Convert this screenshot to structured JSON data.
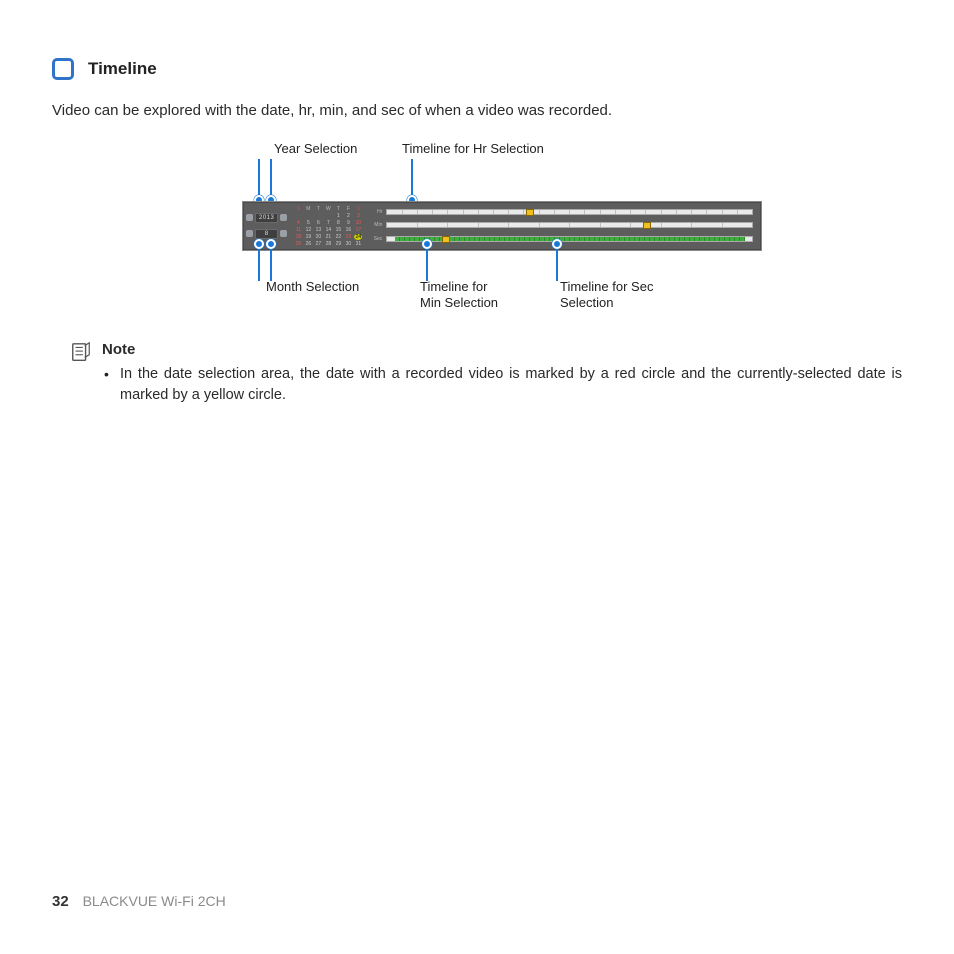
{
  "heading": "Timeline",
  "intro": "Video can be explored with the date, hr, min, and sec of when a video was recorded.",
  "labels": {
    "year": "Year Selection",
    "hr": "Timeline for Hr Selection",
    "month": "Month Selection",
    "min": "Timeline for\nMin Selection",
    "sec": "Timeline for Sec\nSelection"
  },
  "ui": {
    "year": "2013",
    "month": "8",
    "days_header": [
      "S",
      "M",
      "T",
      "W",
      "T",
      "F",
      "S"
    ],
    "tracks": {
      "hr": "Hr",
      "min": "Min",
      "sec": "Sec"
    }
  },
  "note": {
    "title": "Note",
    "bullet": "In the date selection area, the date with a recorded video is marked by a red circle and the currently-selected date is marked by a yellow circle."
  },
  "footer": {
    "page": "32",
    "product": "BLACKVUE Wi-Fi 2CH"
  }
}
